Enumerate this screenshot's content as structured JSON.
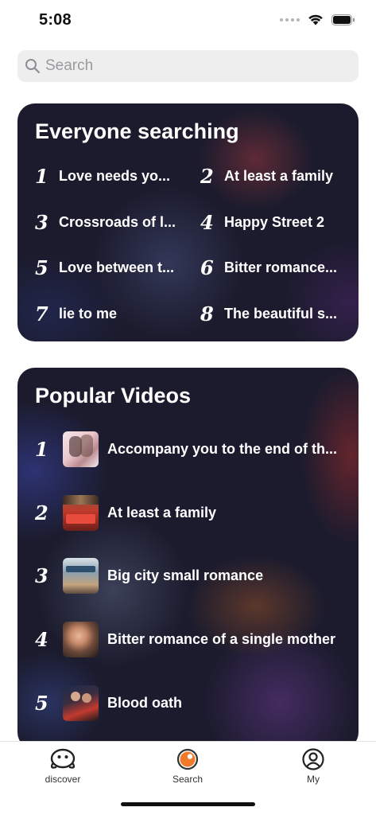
{
  "status_bar": {
    "time": "5:08"
  },
  "search": {
    "placeholder": "Search"
  },
  "everyone_searching": {
    "title": "Everyone searching",
    "items": [
      {
        "rank": "1",
        "label": "Love needs yo..."
      },
      {
        "rank": "2",
        "label": "At least a family"
      },
      {
        "rank": "3",
        "label": "Crossroads of l..."
      },
      {
        "rank": "4",
        "label": "Happy Street 2"
      },
      {
        "rank": "5",
        "label": "Love between t..."
      },
      {
        "rank": "6",
        "label": "Bitter romance..."
      },
      {
        "rank": "7",
        "label": "lie to me"
      },
      {
        "rank": "8",
        "label": "The beautiful s..."
      }
    ]
  },
  "popular_videos": {
    "title": "Popular Videos",
    "items": [
      {
        "rank": "1",
        "title": "Accompany you to the end of th..."
      },
      {
        "rank": "2",
        "title": "At least a family"
      },
      {
        "rank": "3",
        "title": "Big city small romance"
      },
      {
        "rank": "4",
        "title": "Bitter romance of a single mother"
      },
      {
        "rank": "5",
        "title": "Blood oath"
      }
    ]
  },
  "tab_bar": {
    "tabs": [
      {
        "label": "discover",
        "icon": "discover-face-icon"
      },
      {
        "label": "Search",
        "icon": "search-eye-icon",
        "active_color": "#f07a2a"
      },
      {
        "label": "My",
        "icon": "profile-icon"
      }
    ]
  }
}
